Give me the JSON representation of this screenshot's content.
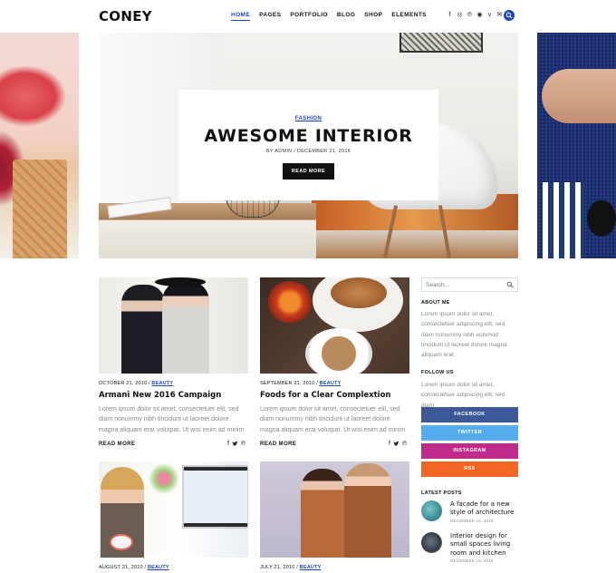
{
  "site": {
    "logo": "CONEY"
  },
  "nav": {
    "items": [
      "HOME",
      "PAGES",
      "PORTFOLIO",
      "BLOG",
      "SHOP",
      "ELEMENTS"
    ],
    "active": "HOME"
  },
  "header_social": {
    "icons": [
      "facebook-icon",
      "instagram-icon",
      "pinterest-icon",
      "dribbble-icon",
      "vimeo-icon",
      "email-icon",
      "rss-icon"
    ],
    "glyphs": [
      "f",
      "◎",
      "℗",
      "◉",
      "v",
      "✉",
      "ᖇ"
    ]
  },
  "hero": {
    "category": "FASHION",
    "title": "AWESOME INTERIOR",
    "meta": "BY ADMIN / DECEMBER 21, 2016",
    "button": "READ MORE"
  },
  "posts": [
    {
      "date": "OCTOBER 21, 2010",
      "category": "BEAUTY",
      "title": "Armani New 2016 Campaign",
      "excerpt": "Lorem ipsum dolor sit amet, consectetuer elit, sed diam nonummy nibh tincidunt ut laoreet dolore magna aliquam erat volutpat. Ut wisi enim ad minim",
      "read_more": "READ MORE"
    },
    {
      "date": "SEPTEMBER 21, 2010",
      "category": "BEAUTY",
      "title": "Foods for a Clear Complextion",
      "excerpt": "Lorem ipsum dolor sit amet, consectetuer elit, sed diam nonummy nibh tincidunt ut laoreet dolore magna aliquam erat volutpat. Ut wisi enim ad minim",
      "read_more": "READ MORE"
    },
    {
      "date": "AUGUST 21, 2010",
      "category": "BEAUTY"
    },
    {
      "date": "JULY 21, 2010",
      "category": "BEAUTY"
    }
  ],
  "share_glyphs": [
    "f",
    "🐦",
    "℗"
  ],
  "sidebar": {
    "search_placeholder": "Search...",
    "about_heading": "ABOUT ME",
    "about_text": "Lorem ipsum dolor sit amet, consectetuer adipiscing elit, sed diam nonummy nibh euismod tincidunt ut laoreet dolore magna aliquam erat",
    "follow_heading": "FOLLOW US",
    "follow_text": "Lorem ipsum dolor sit amet, consectetuer adipiscing elit, sed diam",
    "social_buttons": [
      {
        "label": "FACEBOOK",
        "color": "#3b5998"
      },
      {
        "label": "TWITTER",
        "color": "#55acee"
      },
      {
        "label": "INSTAGRAM",
        "color": "#c02a8a"
      },
      {
        "label": "RSS",
        "color": "#f26522"
      }
    ],
    "latest_heading": "LATEST POSTS",
    "latest_posts": [
      {
        "title": "A facade for a new style of architecture",
        "date": "DECEMBER 15, 2018"
      },
      {
        "title": "Interior design for small spaces living room and kitchen",
        "date": "DECEMBER 15, 2018"
      }
    ]
  },
  "colors": {
    "accent": "#1b47b3",
    "text": "#111111",
    "muted": "#888888"
  }
}
